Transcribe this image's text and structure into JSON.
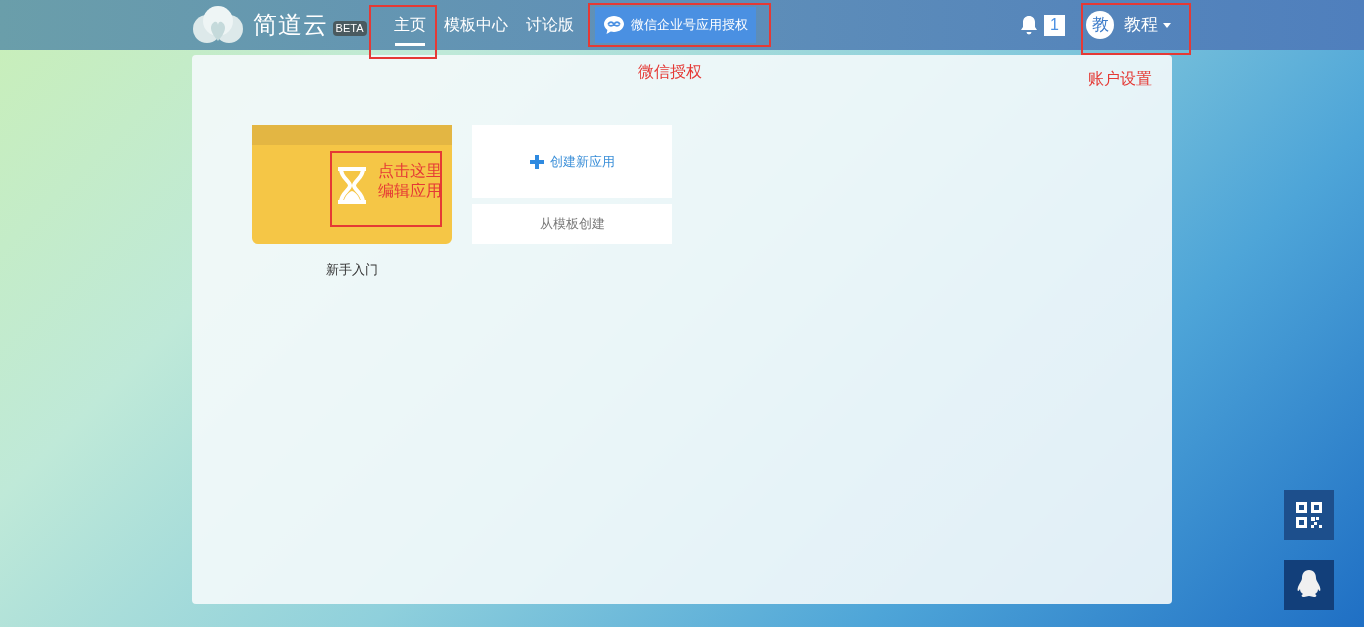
{
  "header": {
    "logo_text": "简道云",
    "beta_badge": "BETA",
    "nav": [
      {
        "label": "主页",
        "selected": true
      },
      {
        "label": "模板中心",
        "selected": false
      },
      {
        "label": "讨论版",
        "selected": false
      }
    ],
    "wechat_button": "微信企业号应用授权",
    "notification_count": "1",
    "avatar_initial": "教",
    "user_name": "教程"
  },
  "apps": [
    {
      "name": "新手入门"
    }
  ],
  "create": {
    "new_app": "创建新应用",
    "from_template": "从模板创建"
  },
  "annotations": {
    "wechat_label": "微信授权",
    "account_label": "账户设置",
    "card_lines": [
      "点击这里",
      "编辑应用"
    ]
  }
}
